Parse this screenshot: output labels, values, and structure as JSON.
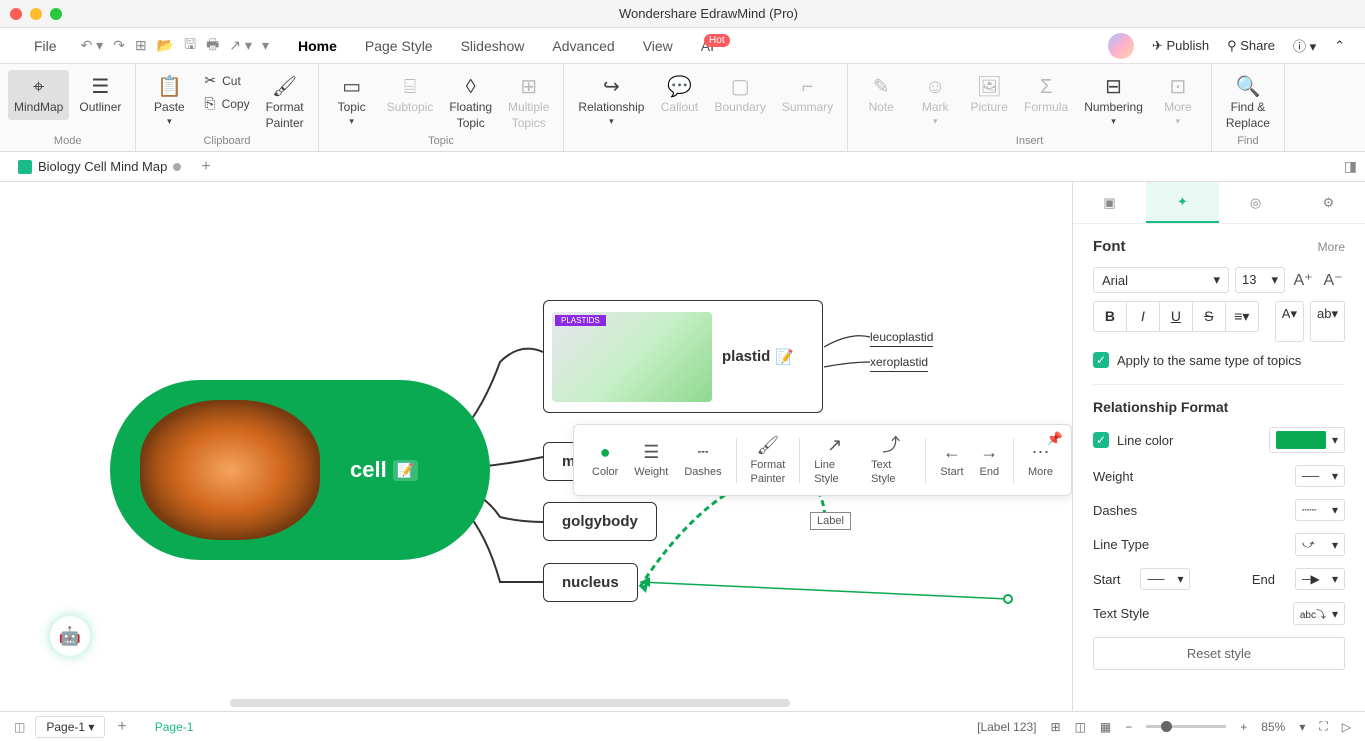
{
  "app": {
    "title": "Wondershare EdrawMind (Pro)"
  },
  "menu": {
    "file": "File",
    "tabs": [
      "Home",
      "Page Style",
      "Slideshow",
      "Advanced",
      "View",
      "AI"
    ],
    "active": "Home",
    "hot": "Hot",
    "publish": "Publish",
    "share": "Share"
  },
  "ribbon": {
    "mode": {
      "label": "Mode",
      "mindmap": "MindMap",
      "outliner": "Outliner"
    },
    "clipboard": {
      "label": "Clipboard",
      "paste": "Paste",
      "cut": "Cut",
      "copy": "Copy",
      "format_painter": "Format\nPainter"
    },
    "topic": {
      "label": "Topic",
      "topic": "Topic",
      "subtopic": "Subtopic",
      "floating": "Floating\nTopic",
      "multiple": "Multiple\nTopics"
    },
    "relationship": "Relationship",
    "callout": "Callout",
    "boundary": "Boundary",
    "summary": "Summary",
    "insert": {
      "label": "Insert",
      "note": "Note",
      "mark": "Mark",
      "picture": "Picture",
      "formula": "Formula",
      "numbering": "Numbering",
      "more": "More"
    },
    "find": {
      "label": "Find",
      "fr": "Find &\nReplace"
    }
  },
  "doc": {
    "name": "Biology Cell Mind Map"
  },
  "mindmap": {
    "center": "cell",
    "plastid": "plastid",
    "plastid_tag": "PLASTIDS",
    "sub1": "m",
    "sub2": "golgybody",
    "sub3": "nucleus",
    "leuco": "leucoplastid",
    "xero": "xeroplastid",
    "rel_label": "Label"
  },
  "float": {
    "color": "Color",
    "weight": "Weight",
    "dashes": "Dashes",
    "fp": "Format\nPainter",
    "linestyle": "Line Style",
    "textstyle": "Text Style",
    "start": "Start",
    "end": "End",
    "more": "More"
  },
  "panel": {
    "font": "Font",
    "more": "More",
    "font_name": "Arial",
    "font_size": "13",
    "apply_same": "Apply to the same type of topics",
    "rel_fmt": "Relationship Format",
    "line_color": "Line color",
    "weight": "Weight",
    "dashes": "Dashes",
    "line_type": "Line Type",
    "start": "Start",
    "end": "End",
    "text_style": "Text Style",
    "reset": "Reset style"
  },
  "status": {
    "page_sel": "Page-1",
    "page_tab": "Page-1",
    "label_ind": "[Label 123]",
    "zoom": "85%"
  }
}
